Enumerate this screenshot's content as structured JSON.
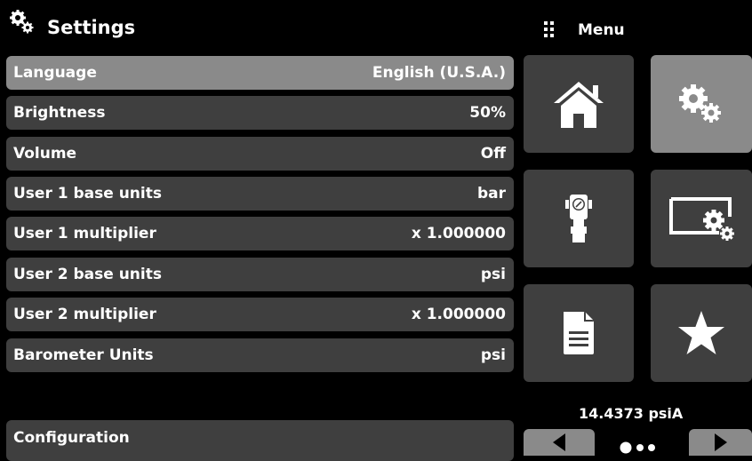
{
  "header": {
    "title": "Settings",
    "menu_label": "Menu"
  },
  "settings_rows": [
    {
      "label": "Language",
      "value": "English (U.S.A.)"
    },
    {
      "label": "Brightness",
      "value": "50%"
    },
    {
      "label": "Volume",
      "value": "Off"
    },
    {
      "label": "User 1 base units",
      "value": "bar"
    },
    {
      "label": "User 1 multiplier",
      "value": "x 1.000000"
    },
    {
      "label": "User 2 base units",
      "value": "psi"
    },
    {
      "label": "User 2 multiplier",
      "value": "x 1.000000"
    },
    {
      "label": "Barometer Units",
      "value": "psi"
    }
  ],
  "configuration": {
    "label": "Configuration"
  },
  "status": {
    "barometer_reading": "14.4373 psiA"
  },
  "menu_tiles": [
    {
      "icon": "home-icon"
    },
    {
      "icon": "gears-icon"
    },
    {
      "icon": "pressure-gauge-icon"
    },
    {
      "icon": "display-settings-icon"
    },
    {
      "icon": "document-icon"
    },
    {
      "icon": "star-icon"
    }
  ],
  "pagination": {
    "current_page": 1,
    "total_pages": 3
  },
  "colors": {
    "background": "#000000",
    "row": "#3f3f3f",
    "row_selected": "#8a8a8a",
    "text": "#ffffff"
  }
}
